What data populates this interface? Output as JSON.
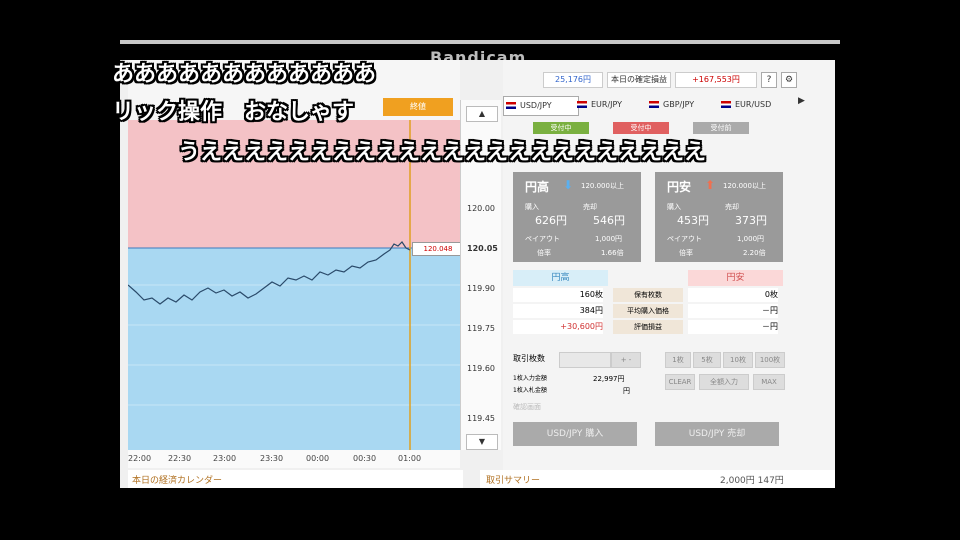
{
  "watermark": "Bandicam",
  "comments": {
    "line1": "ああああああああああああ",
    "line2": "リック操作　おなしゃす",
    "line3": "うえええええええええええええええええええええええ"
  },
  "chart": {
    "badge_top": "終値",
    "badge_bottom": "残り時間",
    "price_tag": "120.048",
    "y_ticks": [
      "120.00",
      "120.05",
      "119.90",
      "119.75",
      "119.60",
      "119.45"
    ],
    "x_ticks": [
      "22:00",
      "22:30",
      "23:00",
      "23:30",
      "00:00",
      "00:30",
      "01:00"
    ],
    "scroll_up": "▲",
    "scroll_down": "▼"
  },
  "header": {
    "balance": "25,176円",
    "daily_btn": "本日の確定損益",
    "profit": "+167,553円",
    "help": "?",
    "settings": "⚙"
  },
  "tabs": [
    "USD/JPY",
    "EUR/JPY",
    "GBP/JPY",
    "EUR/USD"
  ],
  "tabs_next": "▶",
  "strikes": [
    "受付中",
    "受付中",
    "受付前"
  ],
  "cards": {
    "up": {
      "title": "円高",
      "arrow": "⬇",
      "sub": "120.000以上",
      "buy_label": "購入",
      "sell_label": "売却",
      "buy_price": "626円",
      "sell_price": "546円",
      "payout_label": "ペイアウト",
      "payout": "1,000円",
      "volume_label": "倍率",
      "volume": "1.66倍"
    },
    "down": {
      "title": "円安",
      "arrow": "⬆",
      "sub": "120.000以上",
      "buy_label": "購入",
      "sell_label": "売却",
      "buy_price": "453円",
      "sell_price": "373円",
      "payout_label": "ペイアウト",
      "payout": "1,000円",
      "volume_label": "倍率",
      "volume": "2.20倍"
    }
  },
  "positions": {
    "col_left": "円高",
    "col_right": "円安",
    "labels": [
      "保有枚数",
      "平均購入価格",
      "評価損益"
    ],
    "left": [
      "160枚",
      "384円",
      "+30,600円"
    ],
    "right": [
      "0枚",
      "－円",
      "－円"
    ]
  },
  "order": {
    "qty_label": "取引枚数",
    "stepper": "+ -",
    "margin_label": "1枚入力金額",
    "margin_value": "22,997円",
    "max_label": "1枚入札金額",
    "max_value": "円",
    "lot_buttons": [
      "1枚",
      "5枚",
      "10枚",
      "100枚"
    ],
    "extra_buttons": [
      "CLEAR",
      "全額入力",
      "MAX"
    ],
    "confirm_label": "確認画面"
  },
  "actions": {
    "buy": "USD/JPY 購入",
    "sell": "USD/JPY 売却"
  },
  "footer": {
    "calendar": "本日の経済カレンダー",
    "summary": "取引サマリー",
    "summary_value": "2,000円 147円"
  },
  "colors": {
    "upper_zone": "#f4c2c6",
    "lower_zone": "#a9d8f2",
    "price_line": "#2a4a6a",
    "badge": "#f0a020",
    "up_strike": "#7ab040",
    "mid_strike": "#e06060"
  }
}
